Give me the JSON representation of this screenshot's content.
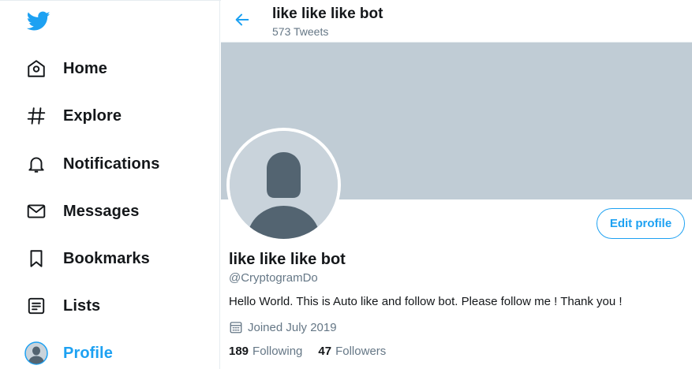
{
  "app": {
    "accent": "#1da1f2",
    "icon": "twitter-bird-icon"
  },
  "sidebar": {
    "items": [
      {
        "label": "Home",
        "icon": "home-icon"
      },
      {
        "label": "Explore",
        "icon": "hashtag-icon"
      },
      {
        "label": "Notifications",
        "icon": "bell-icon"
      },
      {
        "label": "Messages",
        "icon": "envelope-icon"
      },
      {
        "label": "Bookmarks",
        "icon": "bookmark-icon"
      },
      {
        "label": "Lists",
        "icon": "list-icon"
      },
      {
        "label": "Profile",
        "icon": "avatar-icon",
        "active": true
      }
    ]
  },
  "header": {
    "title": "like like like bot",
    "tweet_count": "573 Tweets",
    "back_icon": "arrow-left-icon"
  },
  "profile": {
    "banner_color": "#c0ccd5",
    "edit_button": "Edit profile",
    "name": "like like like bot",
    "handle": "@CryptogramDo",
    "bio": "Hello World. This is Auto like and follow bot. Please follow me ! Thank you !",
    "joined": "Joined July 2019",
    "following_count": "189",
    "following_label": "Following",
    "followers_count": "47",
    "followers_label": "Followers"
  }
}
